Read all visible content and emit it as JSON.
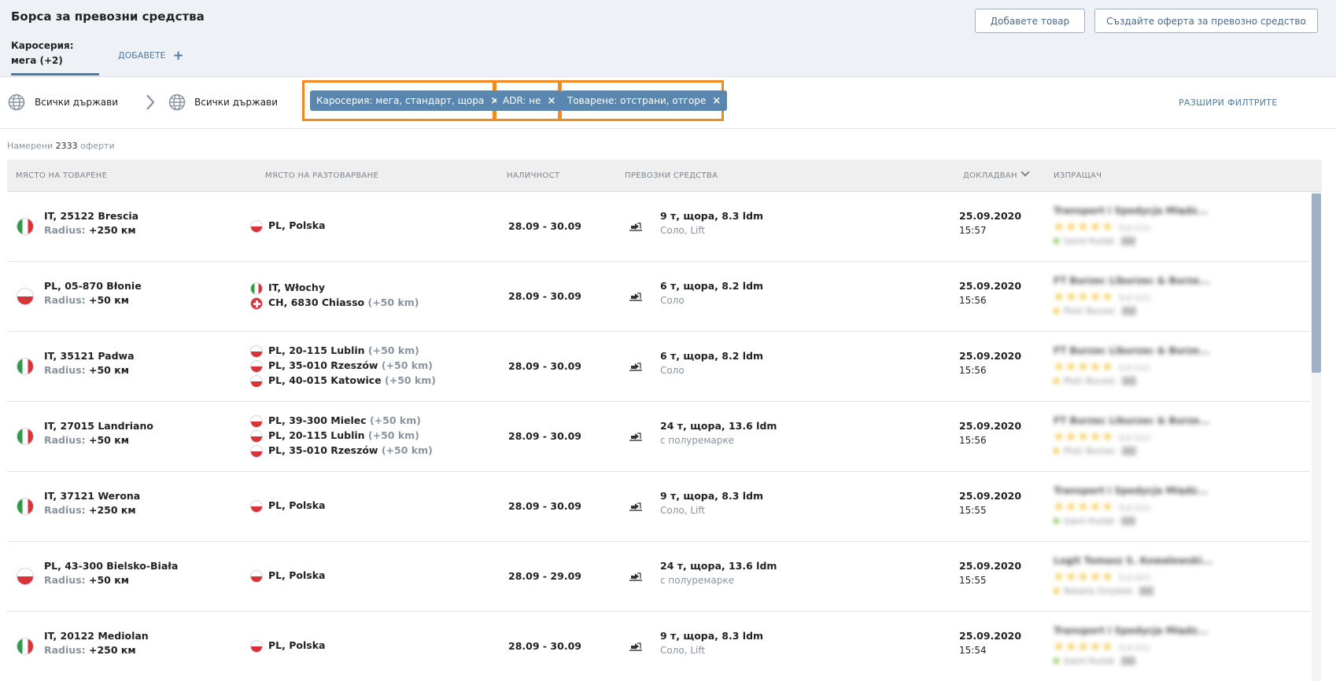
{
  "header": {
    "title": "Борса за превозни средства",
    "add_cargo_label": "Добавете товар",
    "create_offer_label": "Създайте оферта за превозно средство",
    "tab_body_line1": "Каросерия:",
    "tab_body_line2": "мега (+2)",
    "tab_add_label": "ДОБАВЕТЕ",
    "tab_add_icon": "plus-icon"
  },
  "filters": {
    "from_country": "Всички държави",
    "to_country": "Всички държави",
    "globe_icon": "globe-icon",
    "arrow_icon": "chevron-right-icon",
    "chips": [
      {
        "label": "Каросерия: мега, стандарт, щора",
        "remove": "×"
      },
      {
        "label": "ADR: не",
        "remove": "×"
      },
      {
        "label": "Товарене: отстрани, отгоре",
        "remove": "×"
      }
    ],
    "highlight_color": "#f28a1e",
    "chip_color": "#5a87b0",
    "expand_label": "РАЗШИРИ ФИЛТРИТЕ"
  },
  "results": {
    "prefix": "Намерени",
    "count": "2333",
    "suffix": "оферти"
  },
  "columns": {
    "loading": "МЯСТО НА ТОВАРЕНЕ",
    "unloading": "МЯСТО НА РАЗТОВАРВАНЕ",
    "availability": "НАЛИЧНОСТ",
    "vehicles": "ПРЕВОЗНИ СРЕДСТВА",
    "reported": "ДОКЛАДВАН",
    "sender": "ИЗПРАЩАЧ"
  },
  "radius_label": "Radius:",
  "rows": [
    {
      "load_flag": "it",
      "load_place": "IT, 25122 Brescia",
      "load_radius": "+250 км",
      "unloading": [
        {
          "flag": "pl",
          "place": "PL, Polska",
          "extra": ""
        }
      ],
      "availability": "28.09 - 30.09",
      "vehicle": "9 т, щора, 8.3 ldm",
      "vehicle_sub": "Соло, Lift",
      "date": "25.09.2020",
      "time": "15:57",
      "sender_name": "Transport i Spedycja Międz...",
      "sender_rating": "5,0 (11)",
      "sender_contact": "Izard Hużak",
      "sender_dot": "#7ac143"
    },
    {
      "load_flag": "pl",
      "load_place": "PL, 05-870 Błonie",
      "load_radius": "+50 км",
      "unloading": [
        {
          "flag": "it",
          "place": "IT, Włochy",
          "extra": ""
        },
        {
          "flag": "ch",
          "place": "CH, 6830 Chiasso",
          "extra": "(+50 km)"
        }
      ],
      "availability": "28.09 - 30.09",
      "vehicle": "6 т, щора, 8.2 ldm",
      "vehicle_sub": "Соло",
      "date": "25.09.2020",
      "time": "15:56",
      "sender_name": "FT Burzec Liburzec & Burze...",
      "sender_rating": "5,0 (11)",
      "sender_contact": "Piotr Burzec",
      "sender_dot": "#f2c12e"
    },
    {
      "load_flag": "it",
      "load_place": "IT, 35121 Padwa",
      "load_radius": "+50 км",
      "unloading": [
        {
          "flag": "pl",
          "place": "PL, 20-115 Lublin",
          "extra": "(+50 km)"
        },
        {
          "flag": "pl",
          "place": "PL, 35-010 Rzeszów",
          "extra": "(+50 km)"
        },
        {
          "flag": "pl",
          "place": "PL, 40-015 Katowice",
          "extra": "(+50 km)"
        }
      ],
      "availability": "28.09 - 30.09",
      "vehicle": "6 т, щора, 8.2 ldm",
      "vehicle_sub": "Соло",
      "date": "25.09.2020",
      "time": "15:56",
      "sender_name": "FT Burzec Liburzec & Burze...",
      "sender_rating": "5,0 (11)",
      "sender_contact": "Piotr Burzec",
      "sender_dot": "#f2c12e"
    },
    {
      "load_flag": "it",
      "load_place": "IT, 27015 Landriano",
      "load_radius": "+50 км",
      "unloading": [
        {
          "flag": "pl",
          "place": "PL, 39-300 Mielec",
          "extra": "(+50 km)"
        },
        {
          "flag": "pl",
          "place": "PL, 20-115 Lublin",
          "extra": "(+50 km)"
        },
        {
          "flag": "pl",
          "place": "PL, 35-010 Rzeszów",
          "extra": "(+50 km)"
        }
      ],
      "availability": "28.09 - 30.09",
      "vehicle": "24 т, щора, 13.6 ldm",
      "vehicle_sub": "с полуремарке",
      "date": "25.09.2020",
      "time": "15:56",
      "sender_name": "FT Burzec Liburzec & Burze...",
      "sender_rating": "5,0 (11)",
      "sender_contact": "Piotr Burzec",
      "sender_dot": "#f2c12e"
    },
    {
      "load_flag": "it",
      "load_place": "IT, 37121 Werona",
      "load_radius": "+250 км",
      "unloading": [
        {
          "flag": "pl",
          "place": "PL, Polska",
          "extra": ""
        }
      ],
      "availability": "28.09 - 30.09",
      "vehicle": "9 т, щора, 8.3 ldm",
      "vehicle_sub": "Соло, Lift",
      "date": "25.09.2020",
      "time": "15:55",
      "sender_name": "Transport i Spedycja Międz...",
      "sender_rating": "5,0 (11)",
      "sender_contact": "Izard Hużak",
      "sender_dot": "#7ac143"
    },
    {
      "load_flag": "pl",
      "load_place": "PL, 43-300 Bielsko-Biała",
      "load_radius": "+50 км",
      "unloading": [
        {
          "flag": "pl",
          "place": "PL, Polska",
          "extra": ""
        }
      ],
      "availability": "28.09 - 29.09",
      "vehicle": "24 т, щора, 13.6 ldm",
      "vehicle_sub": "с полуремарке",
      "date": "25.09.2020",
      "time": "15:55",
      "sender_name": "Logit Tomasz S. Kowalewski...",
      "sender_rating": "5,0 (47)",
      "sender_contact": "Natalia Grzybek",
      "sender_dot": "#f2c12e"
    },
    {
      "load_flag": "it",
      "load_place": "IT, 20122 Mediolan",
      "load_radius": "+250 км",
      "unloading": [
        {
          "flag": "pl",
          "place": "PL, Polska",
          "extra": ""
        }
      ],
      "availability": "28.09 - 30.09",
      "vehicle": "9 т, щора, 8.3 ldm",
      "vehicle_sub": "Соло, Lift",
      "date": "25.09.2020",
      "time": "15:54",
      "sender_name": "Transport i Spedycja Międz...",
      "sender_rating": "5,0 (11)",
      "sender_contact": "Izard Hużak",
      "sender_dot": "#7ac143"
    }
  ]
}
